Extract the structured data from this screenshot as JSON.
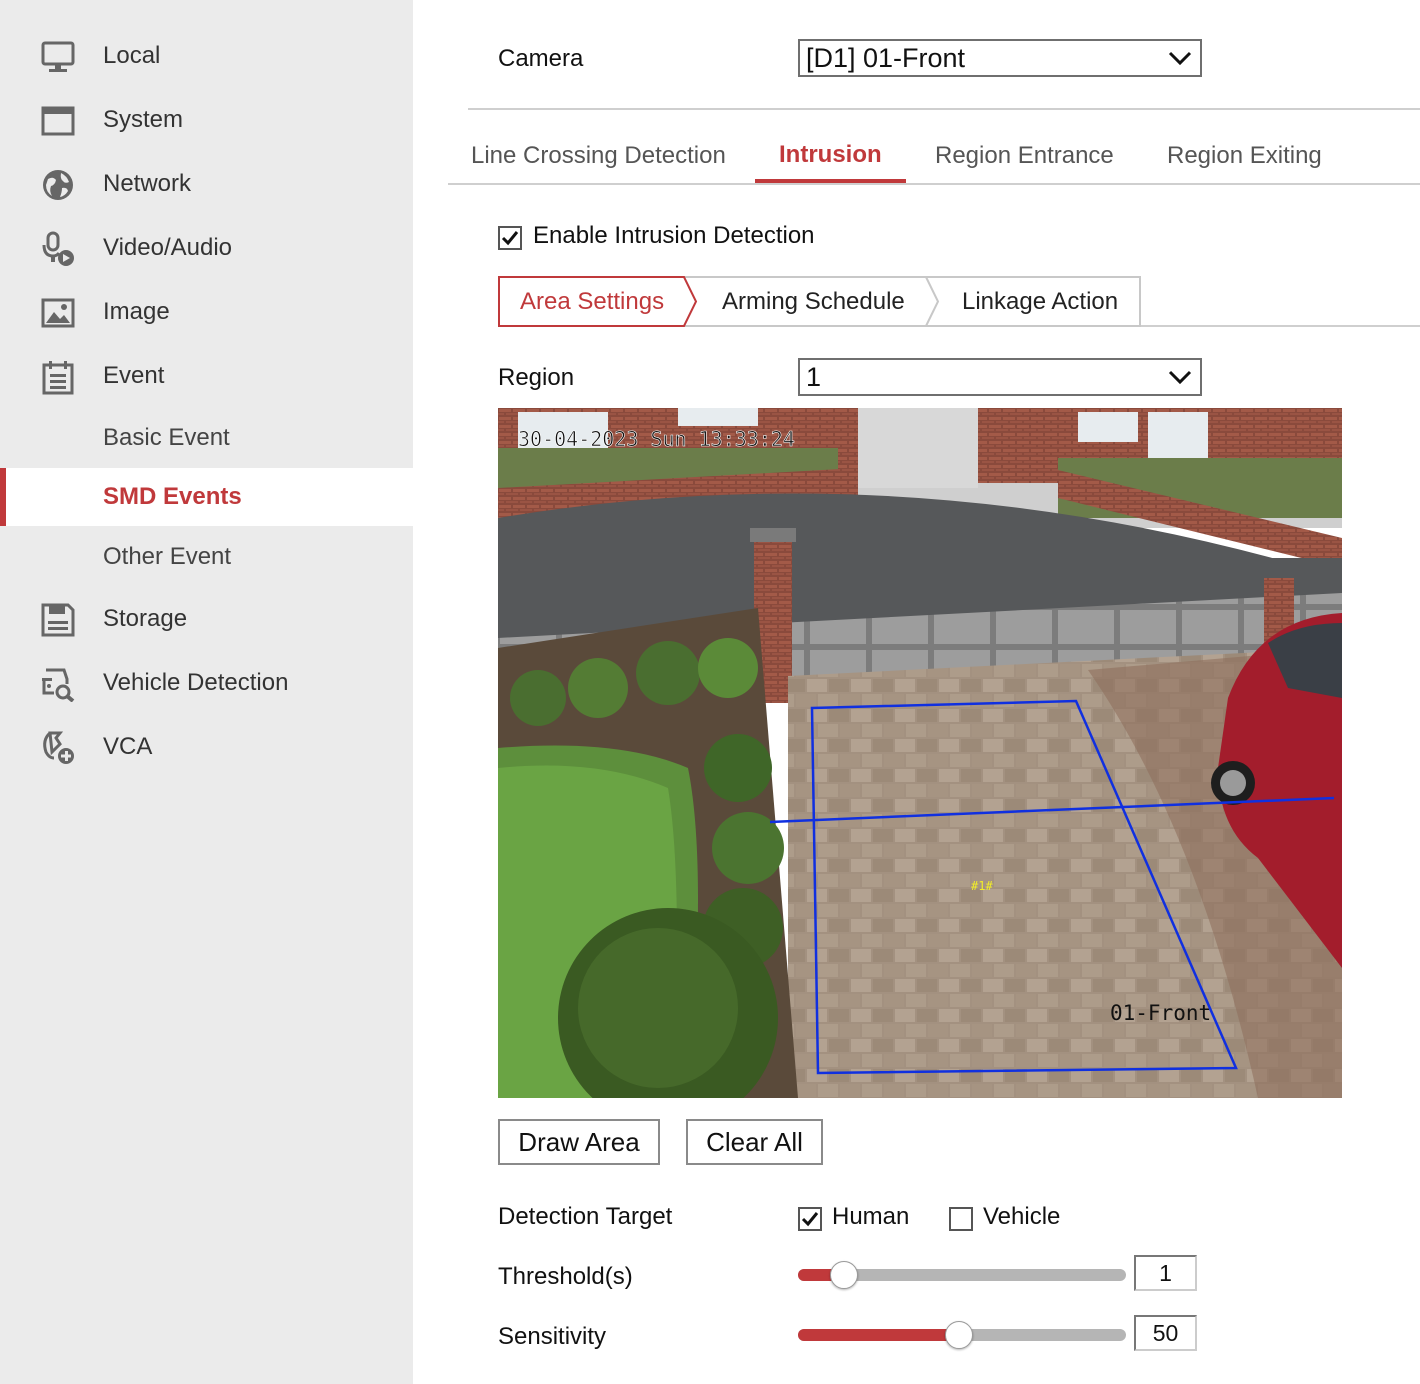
{
  "sidebar": {
    "items": [
      {
        "label": "Local",
        "icon": "monitor-icon"
      },
      {
        "label": "System",
        "icon": "window-icon"
      },
      {
        "label": "Network",
        "icon": "globe-icon"
      },
      {
        "label": "Video/Audio",
        "icon": "microphone-play-icon"
      },
      {
        "label": "Image",
        "icon": "image-icon"
      },
      {
        "label": "Event",
        "icon": "calendar-icon"
      },
      {
        "label": "Basic Event"
      },
      {
        "label": "SMD Events"
      },
      {
        "label": "Other Event"
      },
      {
        "label": "Storage",
        "icon": "floppy-disk-icon"
      },
      {
        "label": "Vehicle Detection",
        "icon": "vehicle-search-icon"
      },
      {
        "label": "VCA",
        "icon": "vca-icon"
      }
    ],
    "active": "SMD Events",
    "accent_color": "#c0393b"
  },
  "camera": {
    "label": "Camera",
    "value": "[D1] 01-Front"
  },
  "tabs": {
    "items": [
      "Line Crossing Detection",
      "Intrusion",
      "Region Entrance",
      "Region Exiting"
    ],
    "active": "Intrusion"
  },
  "enable": {
    "label": "Enable Intrusion Detection",
    "checked": true
  },
  "steps": {
    "items": [
      "Area Settings",
      "Arming Schedule",
      "Linkage Action"
    ],
    "active": "Area Settings"
  },
  "region": {
    "label": "Region",
    "value": "1"
  },
  "video": {
    "timestamp": "30-04-2023 Sun 13:33:24",
    "camera_name": "01-Front",
    "region_tag": "#1#",
    "region_color": "#1030e0"
  },
  "buttons": {
    "draw_area": "Draw Area",
    "clear_all": "Clear All"
  },
  "detection_target": {
    "label": "Detection Target",
    "options": [
      {
        "label": "Human",
        "checked": true
      },
      {
        "label": "Vehicle",
        "checked": false
      }
    ]
  },
  "threshold": {
    "label": "Threshold(s)",
    "value": "1",
    "fraction": 0.14
  },
  "sensitivity": {
    "label": "Sensitivity",
    "value": "50",
    "fraction": 0.49
  }
}
